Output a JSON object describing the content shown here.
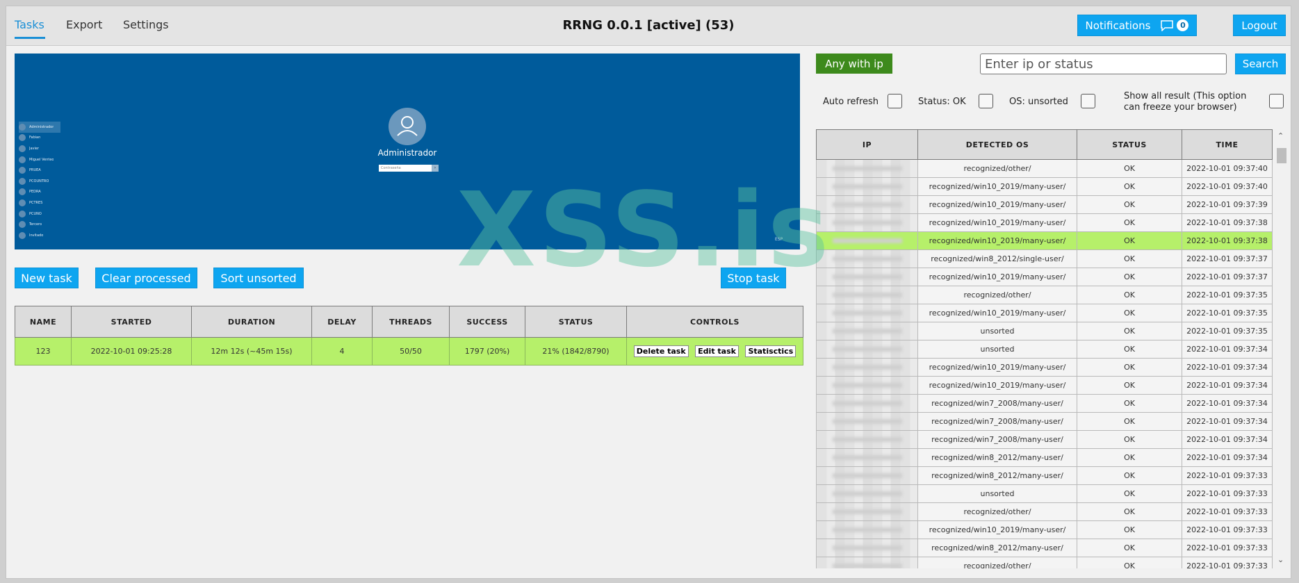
{
  "nav": {
    "tabs": [
      {
        "label": "Tasks",
        "active": true
      },
      {
        "label": "Export",
        "active": false
      },
      {
        "label": "Settings",
        "active": false
      }
    ]
  },
  "header": {
    "title": "RRNG 0.0.1 [active] (53)",
    "notifications_label": "Notifications",
    "notifications_count": "0",
    "logout_label": "Logout"
  },
  "preview": {
    "login_name": "Administrador",
    "password_placeholder": "Contraseña",
    "users": [
      "Administrador",
      "Fabian",
      "Javier",
      "Miguel Venteo",
      "PRUEA",
      "PCOUNTRO",
      "PEDRA",
      "PCTRES",
      "PCUNO",
      "Tercero",
      "Invitado"
    ],
    "corner_text": "ESP"
  },
  "actions": {
    "new_task": "New task",
    "clear_processed": "Clear processed",
    "sort_unsorted": "Sort unsorted",
    "stop_task": "Stop task"
  },
  "watermark": "XSS.is",
  "tasks_table": {
    "headers": [
      "NAME",
      "STARTED",
      "DURATION",
      "DELAY",
      "THREADS",
      "SUCCESS",
      "STATUS",
      "CONTROLS"
    ],
    "rows": [
      {
        "name": "123",
        "started": "2022-10-01 09:25:28",
        "duration": "12m 12s (~45m 15s)",
        "delay": "4",
        "threads": "50/50",
        "success": "1797 (20%)",
        "status": "21% (1842/8790)"
      }
    ],
    "controls": [
      "Delete task",
      "Edit task",
      "Statisctics"
    ]
  },
  "filters": {
    "any_with_ip": "Any with ip",
    "search_placeholder": "Enter ip or status",
    "search_button": "Search",
    "auto_refresh": "Auto refresh",
    "status_ok": "Status: OK",
    "os_unsorted": "OS: unsorted",
    "show_all_line1": "Show all result (This option",
    "show_all_line2": "can freeze your browser)"
  },
  "results_table": {
    "headers": [
      "IP",
      "DETECTED OS",
      "STATUS",
      "TIME"
    ],
    "rows": [
      {
        "os": "recognized/other/",
        "status": "OK",
        "time": "2022-10-01 09:37:40",
        "highlight": false
      },
      {
        "os": "recognized/win10_2019/many-user/",
        "status": "OK",
        "time": "2022-10-01 09:37:40",
        "highlight": false
      },
      {
        "os": "recognized/win10_2019/many-user/",
        "status": "OK",
        "time": "2022-10-01 09:37:39",
        "highlight": false
      },
      {
        "os": "recognized/win10_2019/many-user/",
        "status": "OK",
        "time": "2022-10-01 09:37:38",
        "highlight": false
      },
      {
        "os": "recognized/win10_2019/many-user/",
        "status": "OK",
        "time": "2022-10-01 09:37:38",
        "highlight": true
      },
      {
        "os": "recognized/win8_2012/single-user/",
        "status": "OK",
        "time": "2022-10-01 09:37:37",
        "highlight": false
      },
      {
        "os": "recognized/win10_2019/many-user/",
        "status": "OK",
        "time": "2022-10-01 09:37:37",
        "highlight": false
      },
      {
        "os": "recognized/other/",
        "status": "OK",
        "time": "2022-10-01 09:37:35",
        "highlight": false
      },
      {
        "os": "recognized/win10_2019/many-user/",
        "status": "OK",
        "time": "2022-10-01 09:37:35",
        "highlight": false
      },
      {
        "os": "unsorted",
        "status": "OK",
        "time": "2022-10-01 09:37:35",
        "highlight": false
      },
      {
        "os": "unsorted",
        "status": "OK",
        "time": "2022-10-01 09:37:34",
        "highlight": false
      },
      {
        "os": "recognized/win10_2019/many-user/",
        "status": "OK",
        "time": "2022-10-01 09:37:34",
        "highlight": false
      },
      {
        "os": "recognized/win10_2019/many-user/",
        "status": "OK",
        "time": "2022-10-01 09:37:34",
        "highlight": false
      },
      {
        "os": "recognized/win7_2008/many-user/",
        "status": "OK",
        "time": "2022-10-01 09:37:34",
        "highlight": false
      },
      {
        "os": "recognized/win7_2008/many-user/",
        "status": "OK",
        "time": "2022-10-01 09:37:34",
        "highlight": false
      },
      {
        "os": "recognized/win7_2008/many-user/",
        "status": "OK",
        "time": "2022-10-01 09:37:34",
        "highlight": false
      },
      {
        "os": "recognized/win8_2012/many-user/",
        "status": "OK",
        "time": "2022-10-01 09:37:34",
        "highlight": false
      },
      {
        "os": "recognized/win8_2012/many-user/",
        "status": "OK",
        "time": "2022-10-01 09:37:33",
        "highlight": false
      },
      {
        "os": "unsorted",
        "status": "OK",
        "time": "2022-10-01 09:37:33",
        "highlight": false
      },
      {
        "os": "recognized/other/",
        "status": "OK",
        "time": "2022-10-01 09:37:33",
        "highlight": false
      },
      {
        "os": "recognized/win10_2019/many-user/",
        "status": "OK",
        "time": "2022-10-01 09:37:33",
        "highlight": false
      },
      {
        "os": "recognized/win8_2012/many-user/",
        "status": "OK",
        "time": "2022-10-01 09:37:33",
        "highlight": false
      },
      {
        "os": "recognized/other/",
        "status": "OK",
        "time": "2022-10-01 09:37:33",
        "highlight": false
      }
    ]
  },
  "colors": {
    "accent": "#0ea5f0",
    "highlight_row": "#b6f06a",
    "any_ip_button": "#3d8a1c",
    "preview_bg": "#005b9b"
  }
}
